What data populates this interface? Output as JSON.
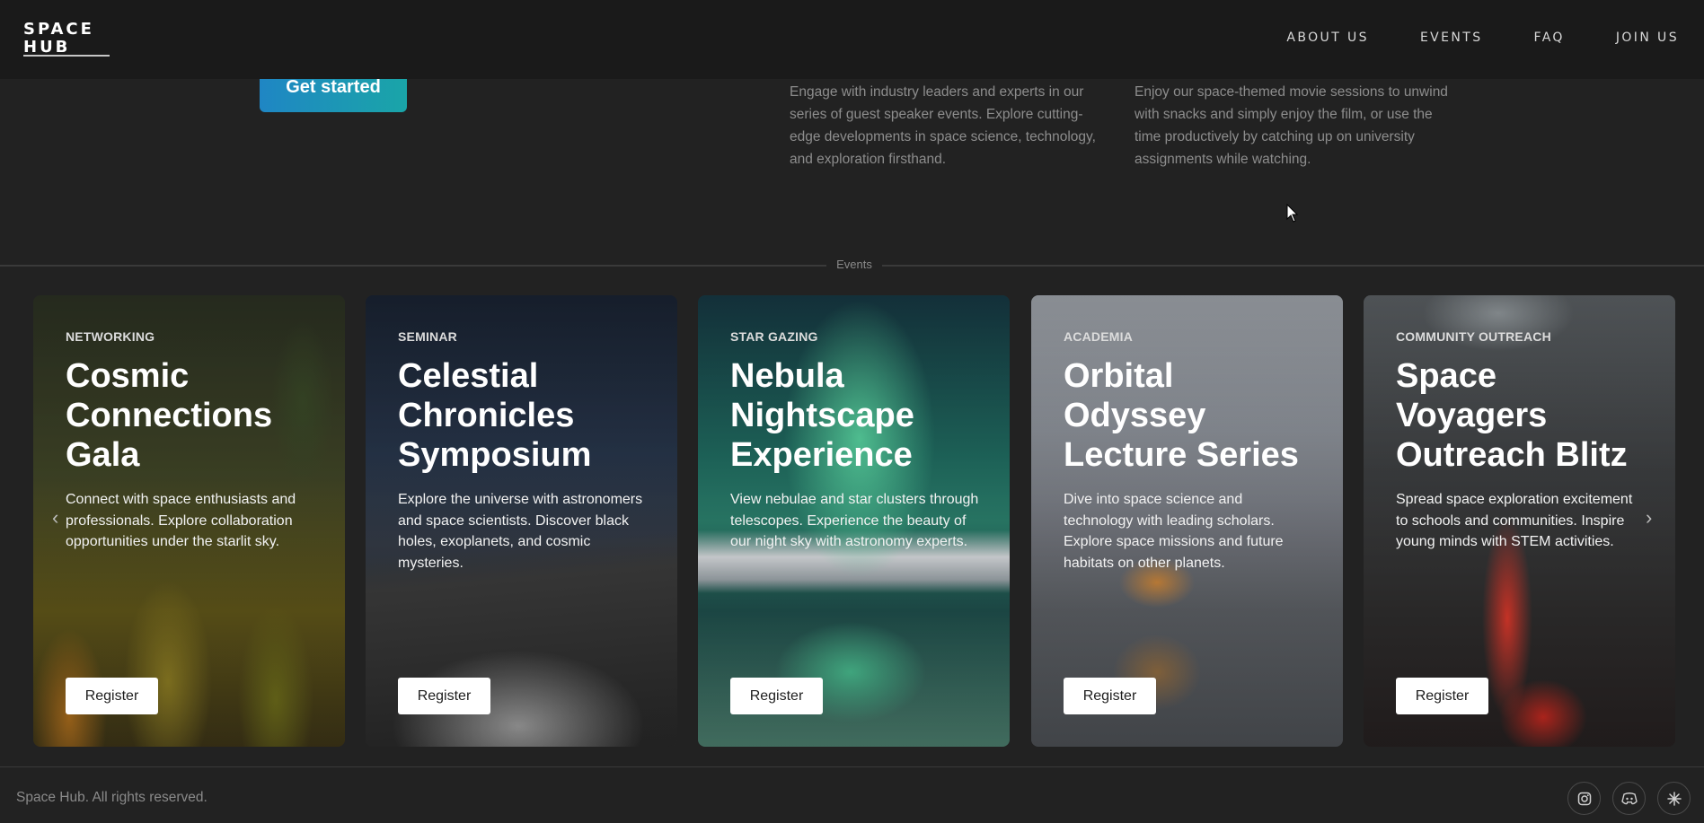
{
  "brand": {
    "logo_text_line1": "SPACE",
    "logo_text_line2": "HUB"
  },
  "nav": {
    "items": [
      "ABOUT US",
      "EVENTS",
      "FAQ",
      "JOIN US"
    ]
  },
  "hero": {
    "get_started_label": "Get started"
  },
  "features": [
    {
      "text": "Engage with industry leaders and experts in our series of guest speaker events. Explore cutting-edge developments in space science, technology, and exploration firsthand."
    },
    {
      "text": "Enjoy our space-themed movie sessions to unwind with snacks and simply enjoy the film, or use the time productively by catching up on university assignments while watching."
    }
  ],
  "events_section": {
    "label": "Events",
    "cards": [
      {
        "tag": "NETWORKING",
        "title": "Cosmic Connections Gala",
        "description": "Connect with space enthusiasts and professionals. Explore collaboration opportunities under the starlit sky.",
        "button": "Register"
      },
      {
        "tag": "SEMINAR",
        "title": "Celestial Chronicles Symposium",
        "description": "Explore the universe with astronomers and space scientists. Discover black holes, exoplanets, and cosmic mysteries.",
        "button": "Register"
      },
      {
        "tag": "STAR GAZING",
        "title": "Nebula Nightscape Experience",
        "description": "View nebulae and star clusters through telescopes. Experience the beauty of our night sky with astronomy experts.",
        "button": "Register"
      },
      {
        "tag": "ACADEMIA",
        "title": "Orbital Odyssey Lecture Series",
        "description": "Dive into space science and technology with leading scholars. Explore space missions and future habitats on other planets.",
        "button": "Register"
      },
      {
        "tag": "COMMUNITY OUTREACH",
        "title": "Space Voyagers Outreach Blitz",
        "description": "Spread space exploration excitement to schools and communities. Inspire young minds with STEM activities.",
        "button": "Register"
      }
    ],
    "prev_arrow": "‹",
    "next_arrow": "›"
  },
  "footer": {
    "copyright": "Space Hub. All rights reserved.",
    "social_icons": [
      "instagram-icon",
      "discord-icon",
      "asterisk-icon"
    ]
  }
}
